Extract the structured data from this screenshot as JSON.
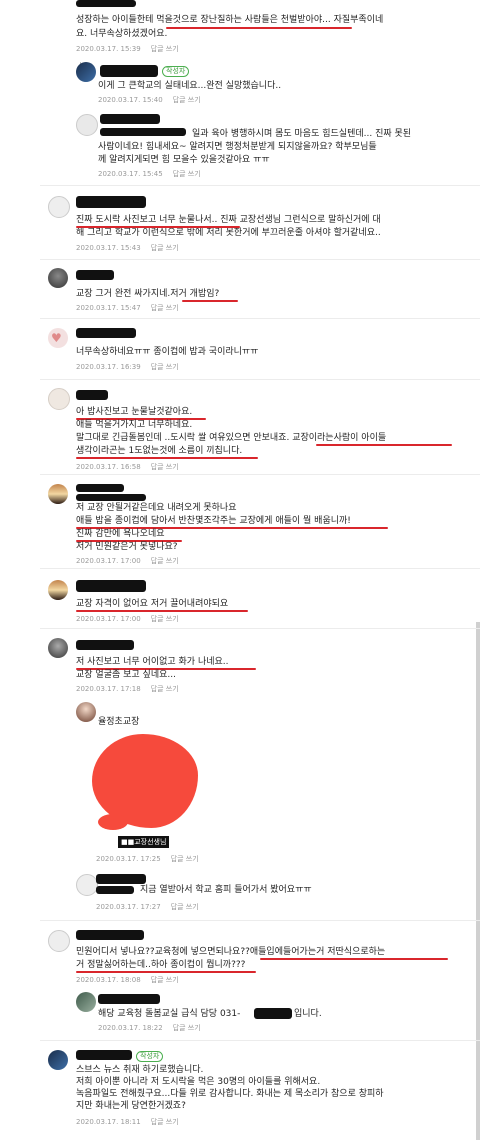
{
  "comments": [
    {
      "text": [
        "성장하는 아이들한테 먹을것으로 장난질하는 사람들은 천벌받아야... 자질부족이네",
        "요. 너무속상하셨겠어요."
      ],
      "time": "2020.03.17. 15:39",
      "reply": "답글 쓰기"
    },
    {
      "badge": "작성자",
      "text": [
        "이게 그 큰학교의 실태네요...완전 실망했습니다.."
      ],
      "time": "2020.03.17. 15:40",
      "reply": "답글 쓰기"
    },
    {
      "text": [
        "일과 육아 병행하시며 몸도 마음도 힘드실텐데... 진짜 못된",
        "사람이네요! 힘내세요~ 알려지면 행정처분받게 되지않을까요? 학부모님들",
        "께 알려지게되면 힘 모을수 있을것같아요 ㅠㅠ"
      ],
      "time": "2020.03.17. 15:45",
      "reply": "답글 쓰기"
    },
    {
      "text": [
        "진짜 도시락 사진보고 너무 눈물나서.. 진짜 교장선생님 그런식으로 말하신거에 대",
        "해 그리고 학교가 이런식으로 밖에 저리 못한거에 부끄러운줄 아셔야 할거같네요.."
      ],
      "time": "2020.03.17. 15:43",
      "reply": "답글 쓰기"
    },
    {
      "text": [
        "교장 그거 완전 싸가지네.저거 개밥임?"
      ],
      "time": "2020.03.17. 15:47",
      "reply": "답글 쓰기"
    },
    {
      "text": [
        "너무속상하네요ㅠㅠ 종이컵에 밥과 국이라니ㅠㅠ"
      ],
      "time": "2020.03.17. 16:39",
      "reply": "답글 쓰기"
    },
    {
      "text": [
        "아 밥사진보고 눈물날것같아요.",
        "애들 먹을거가지고 너무하네요.",
        "말그대로 긴급돌봄인데 ..도시락 쌀 여유있으면 안보내죠. 교장이라는사람이 아이들",
        "생각이라곤는 1도없는것에 소름이 끼칩니다."
      ],
      "time": "2020.03.17. 16:58",
      "reply": "답글 쓰기"
    },
    {
      "text": [
        "저 교장 안될거같은데요 내려오게 못하나요",
        "애들 밥을 종이컵에 담아서 반찬몇조각주는 교장에게 애들이 뭘 배웁니까!",
        "진짜 감만에 욕나오네요",
        "저거 민원같은거 못넣나요?"
      ],
      "time": "2020.03.17. 17:00",
      "reply": "답글 쓰기"
    },
    {
      "text": [
        "교장 자격이 없어요 저거 끌어내려야되요"
      ],
      "time": "2020.03.17. 17:00",
      "reply": "답글 쓰기"
    },
    {
      "text": [
        "저 사진보고 너무 어이없고 화가 나네요..",
        "교장 얼굴좀 보고 싶네요..."
      ],
      "time": "2020.03.17. 17:18",
      "reply": "답글 쓰기"
    },
    {
      "image_caption": "율정초교장",
      "image_label": "교장선생님",
      "time": "2020.03.17. 17:25",
      "reply": "답글 쓰기"
    },
    {
      "text": [
        "지금 열받아서 학교 홈피 들어가서 봤어요ㅠㅠ"
      ],
      "time": "2020.03.17. 17:27",
      "reply": "답글 쓰기"
    },
    {
      "text": [
        "민원어디서 넣나요??교육청에 넣으면되나요??애들입에들어가는거 저딴식으로하는",
        "거 정말싫어하는데..하아 종이컵이 뭡니까???"
      ],
      "time": "2020.03.17. 18:08",
      "reply": "답글 쓰기"
    },
    {
      "text": [
        "해당 교육청 돌봄교실 급식 담당 031-",
        "입니다."
      ],
      "time": "2020.03.17. 18:22",
      "reply": "답글 쓰기"
    },
    {
      "badge": "작성자",
      "text": [
        "스브스 뉴스 취재 하기로했습니다.",
        "저희 아이뿐 아니라 저 도시락을 먹은 30명의 아이들를 위해서요.",
        "녹음파일도 전해줬구요...다들 위로 감사합니다. 화내는 제 목소리가 참으로 창피하",
        "지만 화내는게 당연한거겠죠?"
      ],
      "time": "2020.03.17. 18:11",
      "reply": "답글 쓰기"
    }
  ]
}
